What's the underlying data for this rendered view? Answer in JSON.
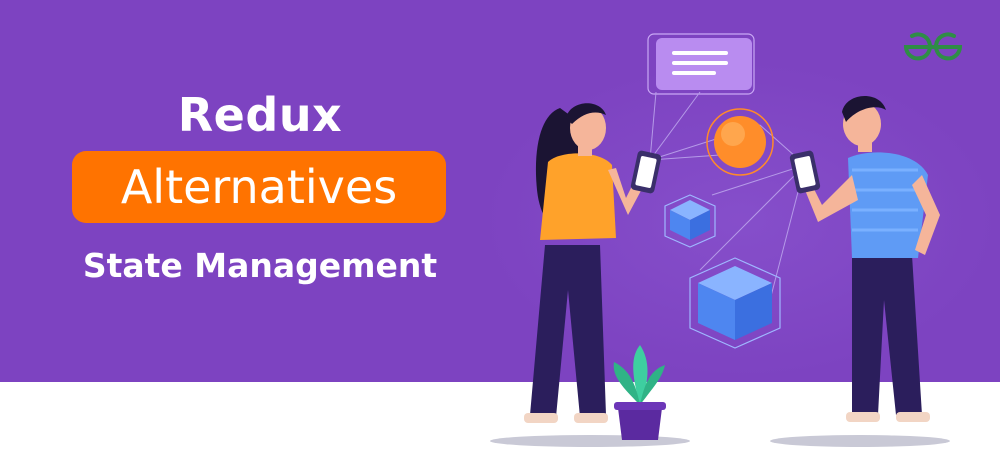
{
  "banner": {
    "title": "Redux",
    "highlight": "Alternatives",
    "subtitle": "State Management",
    "colors": {
      "background": "#7d43c1",
      "accent": "#ff7300",
      "text": "#ffffff",
      "logo": "#2f8d46"
    }
  },
  "logo": {
    "icon": "geeksforgeeks-logo-icon"
  },
  "illustration": {
    "icons": [
      "woman-with-phone",
      "man-with-phone",
      "chat-bubble-icon",
      "orange-sphere-icon",
      "cube-icon",
      "plant-pot-icon"
    ]
  }
}
